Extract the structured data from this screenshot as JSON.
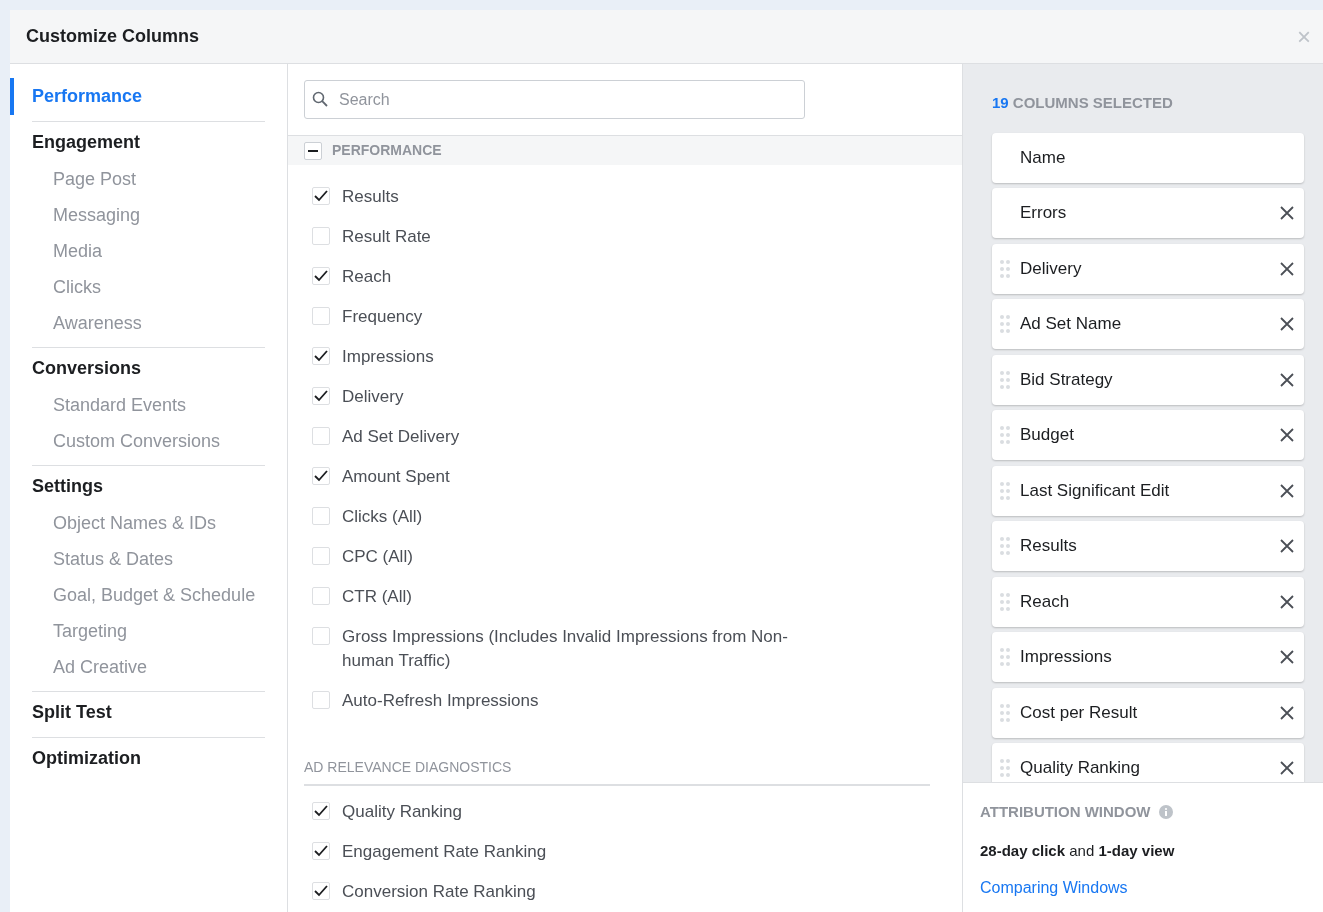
{
  "dialog": {
    "title": "Customize Columns",
    "close": "×"
  },
  "sidebar": {
    "groups": [
      {
        "label": "Performance",
        "selected": true
      },
      {
        "label": "Engagement",
        "selected": false,
        "children": [
          {
            "label": "Page Post"
          },
          {
            "label": "Messaging"
          },
          {
            "label": "Media"
          },
          {
            "label": "Clicks"
          },
          {
            "label": "Awareness"
          }
        ]
      },
      {
        "label": "Conversions",
        "selected": false,
        "children": [
          {
            "label": "Standard Events"
          },
          {
            "label": "Custom Conversions"
          }
        ]
      },
      {
        "label": "Settings",
        "selected": false,
        "children": [
          {
            "label": "Object Names & IDs"
          },
          {
            "label": "Status & Dates"
          },
          {
            "label": "Goal, Budget & Schedule"
          },
          {
            "label": "Targeting"
          },
          {
            "label": "Ad Creative"
          }
        ]
      },
      {
        "label": "Split Test",
        "selected": false
      },
      {
        "label": "Optimization",
        "selected": false
      }
    ]
  },
  "search": {
    "placeholder": "Search"
  },
  "section": {
    "title": "PERFORMANCE",
    "expanded": true,
    "groups": [
      {
        "items": [
          {
            "label": "Results",
            "checked": true
          },
          {
            "label": "Result Rate",
            "checked": false
          },
          {
            "label": "Reach",
            "checked": true
          },
          {
            "label": "Frequency",
            "checked": false
          },
          {
            "label": "Impressions",
            "checked": true
          },
          {
            "label": "Delivery",
            "checked": true
          },
          {
            "label": "Ad Set Delivery",
            "checked": false
          },
          {
            "label": "Amount Spent",
            "checked": true
          },
          {
            "label": "Clicks (All)",
            "checked": false
          },
          {
            "label": "CPC (All)",
            "checked": false
          },
          {
            "label": "CTR (All)",
            "checked": false
          },
          {
            "label": "Gross Impressions (Includes Invalid Impressions from Non-human Traffic)",
            "checked": false
          },
          {
            "label": "Auto-Refresh Impressions",
            "checked": false
          }
        ]
      },
      {
        "heading": "AD RELEVANCE DIAGNOSTICS",
        "items": [
          {
            "label": "Quality Ranking",
            "checked": true
          },
          {
            "label": "Engagement Rate Ranking",
            "checked": true
          },
          {
            "label": "Conversion Rate Ranking",
            "checked": true
          }
        ]
      }
    ]
  },
  "selected_columns": {
    "count": "19",
    "label": "COLUMNS SELECTED",
    "columns": [
      {
        "label": "Name",
        "draggable": false,
        "removable": false
      },
      {
        "label": "Errors",
        "draggable": false,
        "removable": true
      },
      {
        "label": "Delivery",
        "draggable": true,
        "removable": true
      },
      {
        "label": "Ad Set Name",
        "draggable": true,
        "removable": true
      },
      {
        "label": "Bid Strategy",
        "draggable": true,
        "removable": true
      },
      {
        "label": "Budget",
        "draggable": true,
        "removable": true
      },
      {
        "label": "Last Significant Edit",
        "draggable": true,
        "removable": true
      },
      {
        "label": "Results",
        "draggable": true,
        "removable": true
      },
      {
        "label": "Reach",
        "draggable": true,
        "removable": true
      },
      {
        "label": "Impressions",
        "draggable": true,
        "removable": true
      },
      {
        "label": "Cost per Result",
        "draggable": true,
        "removable": true
      },
      {
        "label": "Quality Ranking",
        "draggable": true,
        "removable": true
      }
    ]
  },
  "attribution": {
    "title": "ATTRIBUTION WINDOW",
    "text": "**28-day click** and **1-day view**",
    "link": "Comparing Windows"
  }
}
